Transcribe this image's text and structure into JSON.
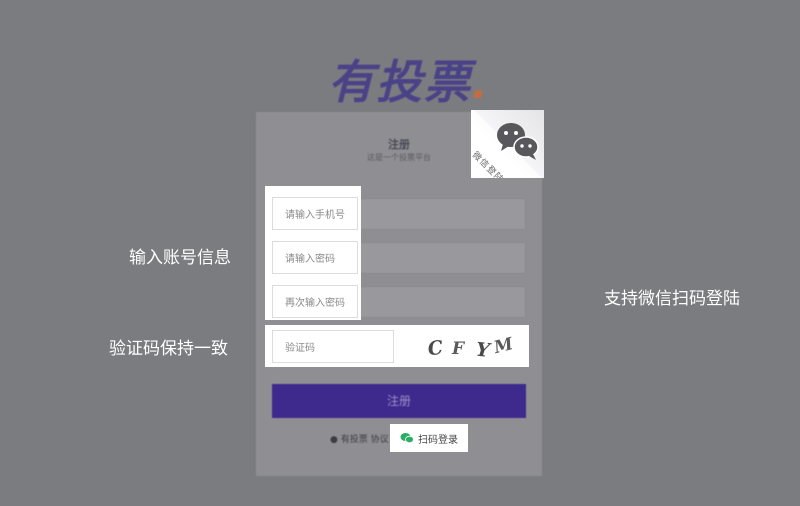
{
  "logo": {
    "text": "有投票",
    "dot": "."
  },
  "card": {
    "title": "注册",
    "subtitle": "这是一个投票平台"
  },
  "fields": {
    "phone_placeholder": "请输入手机号",
    "password_placeholder": "请输入密码",
    "confirm_placeholder": "再次输入密码",
    "captcha_placeholder": "验证码"
  },
  "captcha": {
    "chars": [
      "C",
      "F",
      "Y",
      "M"
    ]
  },
  "qr": {
    "label": "微信登陆"
  },
  "submit": {
    "label": "注册"
  },
  "agree": {
    "text": "有投票 协议"
  },
  "scan": {
    "label": "扫码登录"
  },
  "annotations": {
    "account": "输入账号信息",
    "captcha": "验证码保持一致",
    "wechat": "支持微信扫码登陆"
  },
  "colors": {
    "brand": "#3a2f8a",
    "accent": "#e0672b",
    "wechat": "#2aae67"
  }
}
